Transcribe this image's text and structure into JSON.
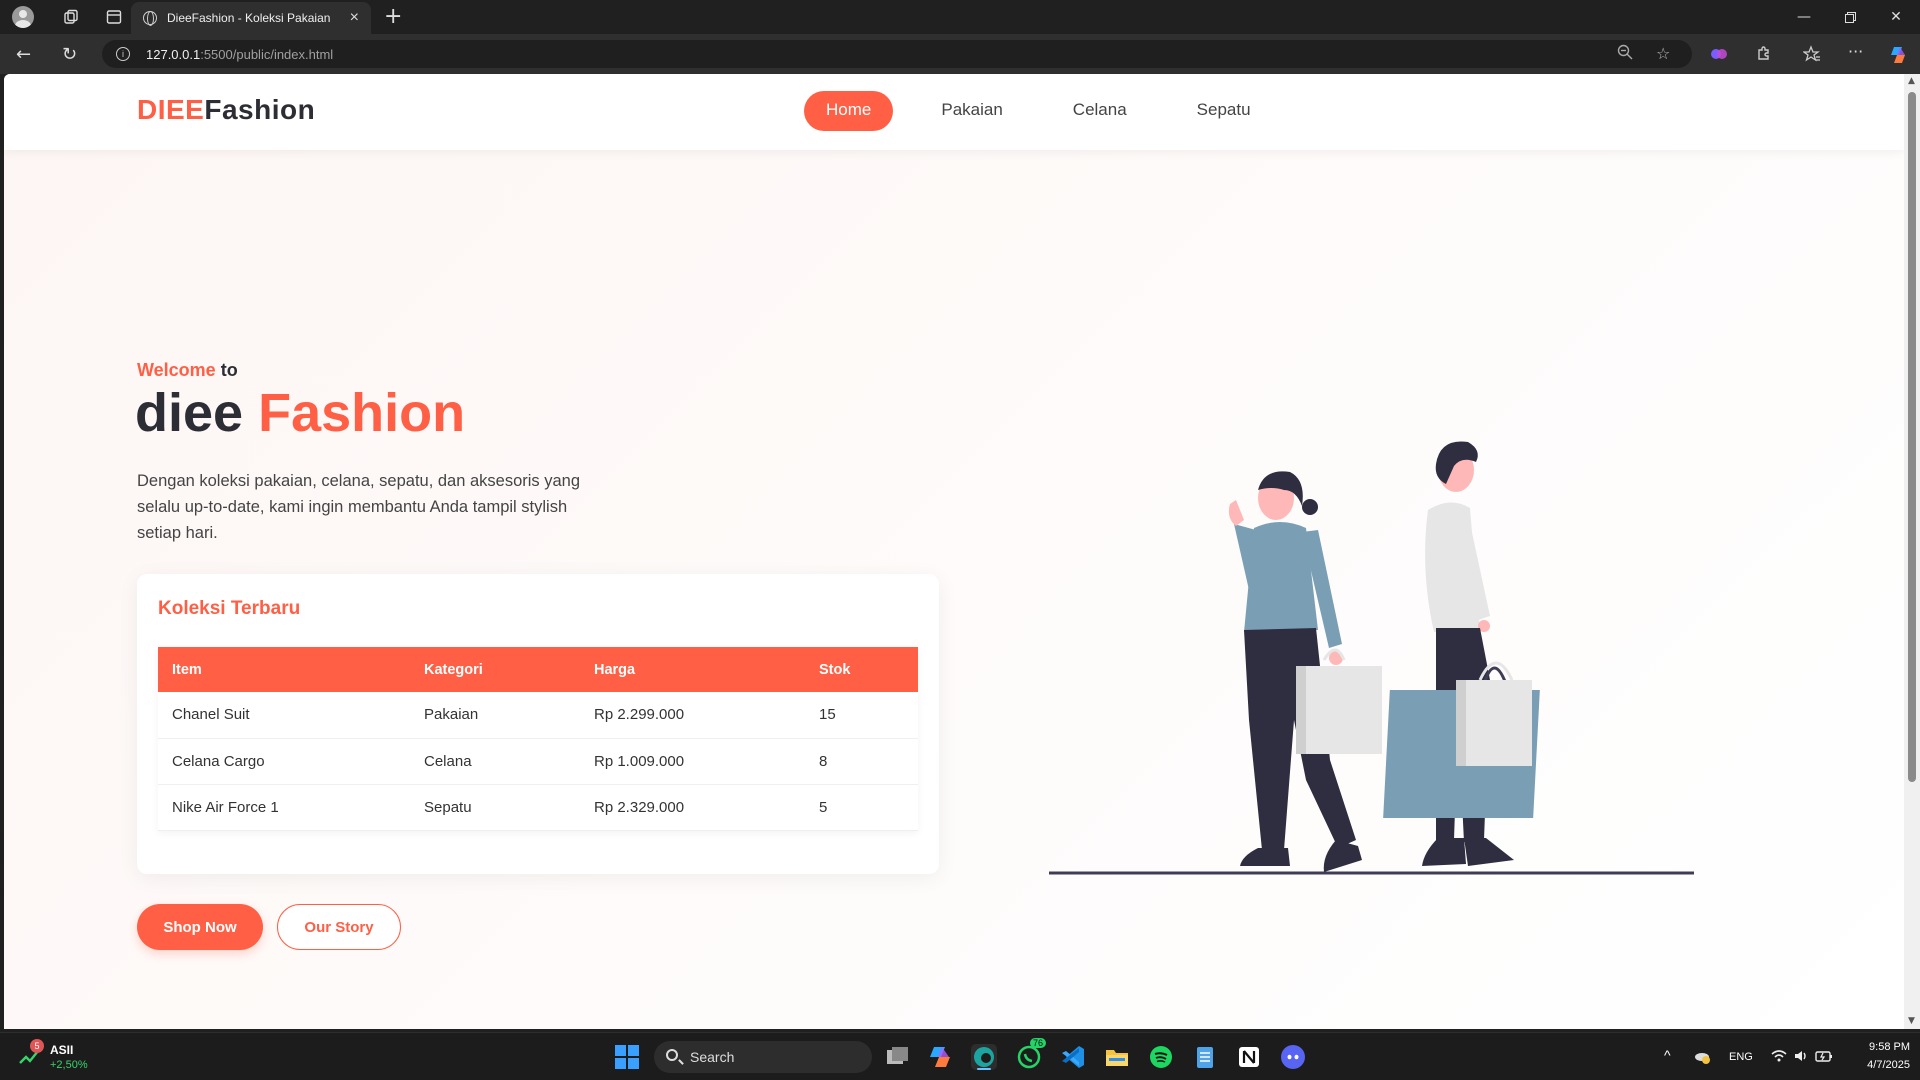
{
  "browser": {
    "tab_title": "DieeFashion - Koleksi Pakaian",
    "url_host": "127.0.0.1",
    "url_path": ":5500/public/index.html"
  },
  "site": {
    "logo_accent": "DIEE",
    "logo_rest": "Fashion",
    "nav": [
      {
        "label": "Home",
        "active": true
      },
      {
        "label": "Pakaian",
        "active": false
      },
      {
        "label": "Celana",
        "active": false
      },
      {
        "label": "Sepatu",
        "active": false
      }
    ]
  },
  "hero": {
    "welcome_accent": "Welcome",
    "welcome_rest": "to",
    "headline_main": "diee",
    "headline_accent": "Fashion",
    "description": "Dengan koleksi pakaian, celana, sepatu, dan aksesoris yang selalu up-to-date, kami ingin membantu Anda tampil stylish setiap hari.",
    "primary_button": "Shop Now",
    "secondary_button": "Our Story"
  },
  "collection": {
    "title": "Koleksi Terbaru",
    "headers": [
      "Item",
      "Kategori",
      "Harga",
      "Stok"
    ],
    "rows": [
      [
        "Chanel Suit",
        "Pakaian",
        "Rp 2.299.000",
        "15"
      ],
      [
        "Celana Cargo",
        "Celana",
        "Rp 1.009.000",
        "8"
      ],
      [
        "Nike Air Force 1",
        "Sepatu",
        "Rp 2.329.000",
        "5"
      ]
    ]
  },
  "taskbar": {
    "search_label": "Search",
    "stock_name": "ASII",
    "stock_change": "+2,50%",
    "stock_badge": "5",
    "whatsapp_badge": "76",
    "language": "ENG",
    "time": "9:58 PM",
    "date": "4/7/2025"
  },
  "colors": {
    "accent": "#ff5f45",
    "dark_text": "#2d2d35"
  }
}
